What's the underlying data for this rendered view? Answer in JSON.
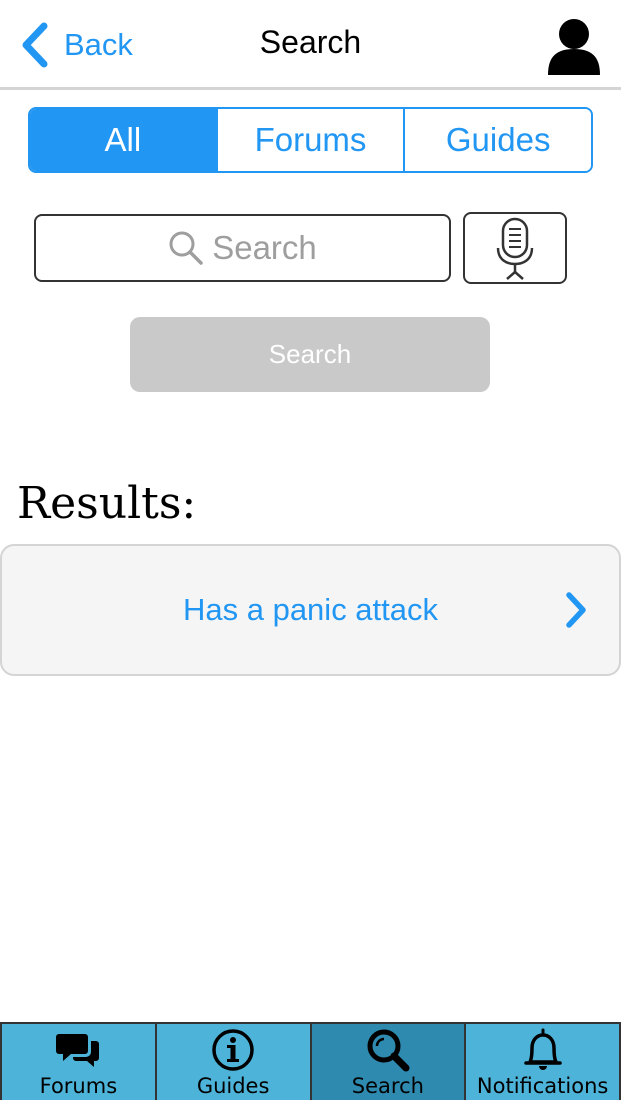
{
  "header": {
    "back_label": "Back",
    "title": "Search"
  },
  "segments": [
    {
      "label": "All",
      "active": true
    },
    {
      "label": "Forums",
      "active": false
    },
    {
      "label": "Guides",
      "active": false
    }
  ],
  "search": {
    "placeholder": "Search",
    "submit_label": "Search"
  },
  "results": {
    "heading": "Results:",
    "items": [
      {
        "label": "Has a panic attack"
      }
    ]
  },
  "tabbar": [
    {
      "label": "Forums",
      "icon": "forums-icon"
    },
    {
      "label": "Guides",
      "icon": "info-icon"
    },
    {
      "label": "Search",
      "icon": "search-icon",
      "active": true
    },
    {
      "label": "Notifications",
      "icon": "bell-icon"
    }
  ],
  "colors": {
    "accent": "#2196f3",
    "tab_bg": "#4db3d8",
    "tab_active_bg": "#2f8ab0",
    "submit_disabled": "#c9c9c9"
  }
}
